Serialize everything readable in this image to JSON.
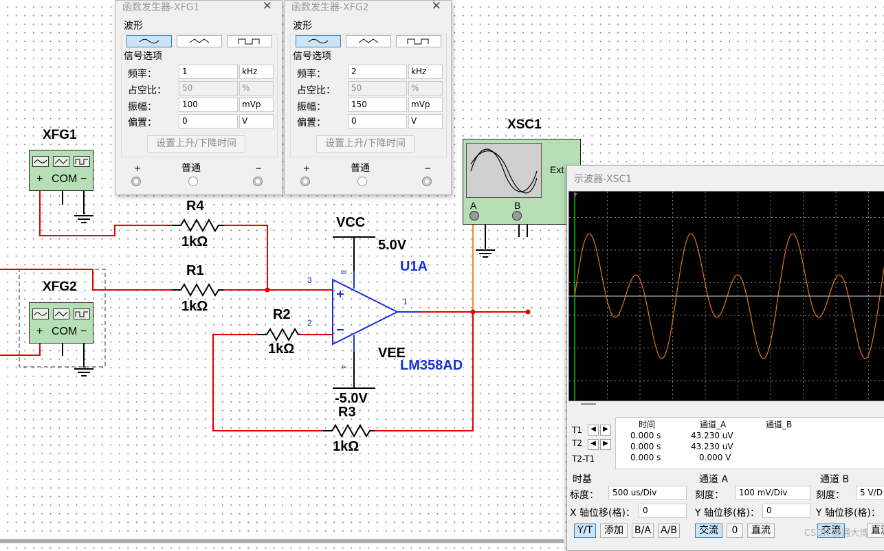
{
  "circuit": {
    "xfg1_label": "XFG1",
    "xfg2_label": "XFG2",
    "xsc1_label": "XSC1",
    "com_label": "COM",
    "plus": "+",
    "minus": "−",
    "r4": {
      "ref": "R4",
      "value": "1kΩ"
    },
    "r1": {
      "ref": "R1",
      "value": "1kΩ"
    },
    "r2": {
      "ref": "R2",
      "value": "1kΩ"
    },
    "r3": {
      "ref": "R3",
      "value": "1kΩ"
    },
    "vcc": {
      "name": "VCC",
      "value": "5.0V"
    },
    "vee": {
      "name": "VEE",
      "value": "-5.0V"
    },
    "opamp": {
      "ref": "U1A",
      "part": "LM358AD"
    },
    "pins": {
      "p3": "3",
      "p2": "2",
      "p1": "1",
      "p8": "8",
      "p4": "4"
    },
    "scope_ext": "Ext",
    "scope_a": "A",
    "scope_b": "B"
  },
  "fg_common": {
    "section_waveform": "波形",
    "section_options": "信号选项",
    "label_freq": "频率：",
    "label_duty": "占空比：",
    "label_amp": "振幅：",
    "label_offset": "偏置：",
    "rise_fall_button": "设置上升/下降时间",
    "terminal_plus": "+",
    "terminal_common": "普通",
    "terminal_minus": "−",
    "selected_waveform": "sine",
    "waveform_icons": [
      "sine-wave-icon",
      "triangle-wave-icon",
      "square-wave-icon"
    ]
  },
  "xfg1_window": {
    "title": "函数发生器-XFG1",
    "freq": "1",
    "freq_unit": "kHz",
    "duty": "50",
    "duty_unit": "%",
    "amp": "100",
    "amp_unit": "mVp",
    "offset": "0",
    "offset_unit": "V"
  },
  "xfg2_window": {
    "title": "函数发生器-XFG2",
    "freq": "2",
    "freq_unit": "kHz",
    "duty": "50",
    "duty_unit": "%",
    "amp": "150",
    "amp_unit": "mVp",
    "offset": "0",
    "offset_unit": "V"
  },
  "scope": {
    "title": "示波器-XSC1",
    "trace_color": "#e8781e",
    "screen_bg": "#000000",
    "cursor_color": "#00c800",
    "readout": {
      "headers": [
        "时间",
        "通道_A",
        "通道_B"
      ],
      "rows": [
        {
          "label": "T1",
          "time": "0.000 s",
          "ch_a": "43.230 uV",
          "ch_b": ""
        },
        {
          "label": "T2",
          "time": "0.000 s",
          "ch_a": "43.230 uV",
          "ch_b": ""
        },
        {
          "label": "T2-T1",
          "time": "0.000 s",
          "ch_a": "0.000 V",
          "ch_b": ""
        }
      ]
    },
    "timebase": {
      "section": "时基",
      "scale_label": "标度：",
      "scale": "500 us/Div",
      "xpos_label": "X 轴位移(格)：",
      "xpos": "0",
      "buttons": [
        "Y/T",
        "添加",
        "B/A",
        "A/B"
      ]
    },
    "channel_a": {
      "section": "通道 A",
      "scale_label": "刻度：",
      "scale": "100 mV/Div",
      "ypos_label": "Y 轴位移(格)：",
      "ypos": "0",
      "buttons": [
        "交流",
        "0",
        "直流"
      ]
    },
    "channel_b": {
      "section": "通道 B",
      "scale_label": "刻度：",
      "scale": "5  V/D",
      "ypos_label": "Y 轴位移(格)：",
      "buttons": [
        "交流",
        "直流"
      ]
    }
  },
  "watermark": "CSDN @通大博"
}
